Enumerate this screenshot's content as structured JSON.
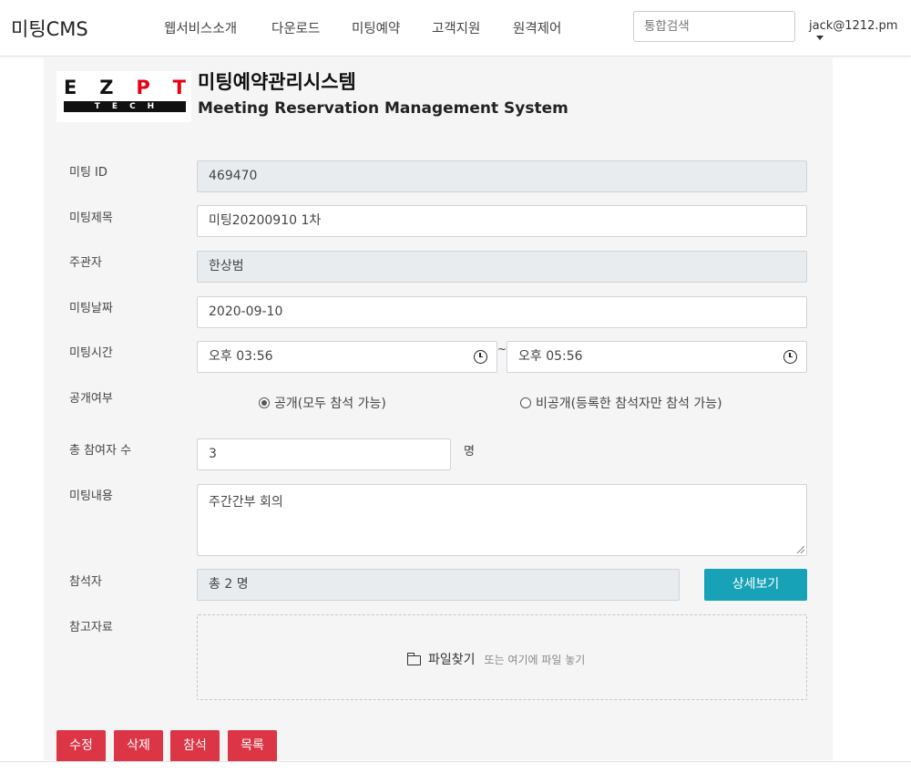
{
  "navbar": {
    "brand": "미팅CMS",
    "menu": [
      "웹서비스소개",
      "다운로드",
      "미팅예약",
      "고객지원",
      "원격제어"
    ],
    "search_placeholder": "통합검색",
    "user": "jack@1212.pm"
  },
  "logo": {
    "letters": [
      "E",
      "Z",
      "P",
      "T"
    ],
    "letter_colors": [
      "#111111",
      "#111111",
      "#e60012",
      "#e60012"
    ],
    "subtext": "TECH"
  },
  "header": {
    "title": "미팅예약관리시스템",
    "subtitle": "Meeting Reservation Management System"
  },
  "form": {
    "meeting_id": {
      "label": "미팅 ID",
      "value": "469470"
    },
    "title": {
      "label": "미팅제목",
      "value": "미팅20200910 1차"
    },
    "host": {
      "label": "주관자",
      "value": "한상범"
    },
    "date": {
      "label": "미팅날짜",
      "value": "2020-09-10"
    },
    "time": {
      "label": "미팅시간",
      "start": "오후 03:56",
      "separator": "~",
      "end": "오후 05:56"
    },
    "visibility": {
      "label": "공개여부",
      "options": [
        "공개(모두 참석 가능)",
        "비공개(등록한 참석자만 참석 가능)"
      ],
      "selected": 0
    },
    "participant_count": {
      "label": "총 참여자 수",
      "value": "3",
      "unit": "명"
    },
    "content": {
      "label": "미팅내용",
      "value": "주간간부 회의"
    },
    "attendees": {
      "label": "참석자",
      "value": "총 2 명",
      "detail_button": "상세보기"
    },
    "attachments": {
      "label": "참고자료",
      "find_button": "파일찾기",
      "hint": "또는 여기에 파일 놓기"
    }
  },
  "actions": [
    "수정",
    "삭제",
    "참석",
    "목록"
  ],
  "colors": {
    "primary_danger": "#dc3545",
    "info": "#17a2b8",
    "readonly_bg": "#e9ecef"
  }
}
